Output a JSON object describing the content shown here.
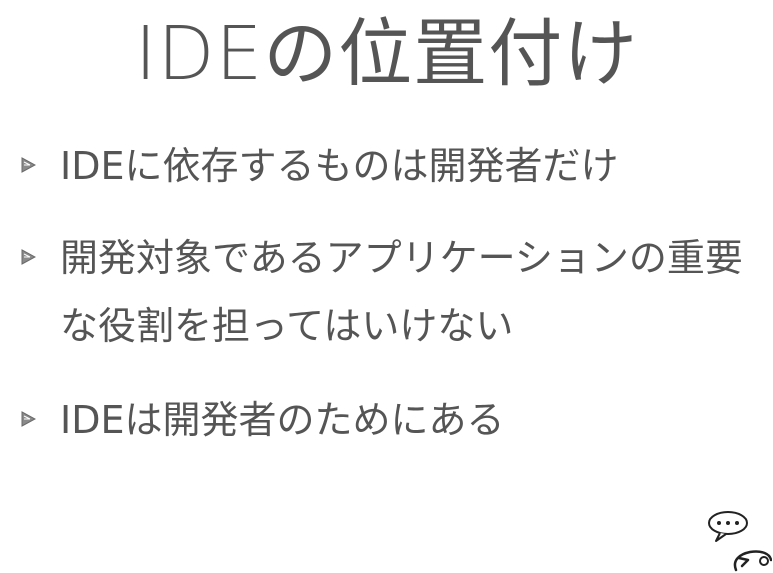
{
  "slide": {
    "title": "IDEの位置付け",
    "bullets": [
      {
        "text": "IDEに依存するものは開発者だけ"
      },
      {
        "text": "開発対象であるアプリケーションの重要な役割を担ってはいけない"
      },
      {
        "text": "IDEは開発者のためにある"
      }
    ]
  },
  "colors": {
    "text": "#555555",
    "bullet_fill": "#8a8a8a",
    "background": "#ffffff"
  },
  "icons": {
    "bullet": "triangle-bullet-icon",
    "mascot": "speech-bubble-mascot-icon"
  }
}
